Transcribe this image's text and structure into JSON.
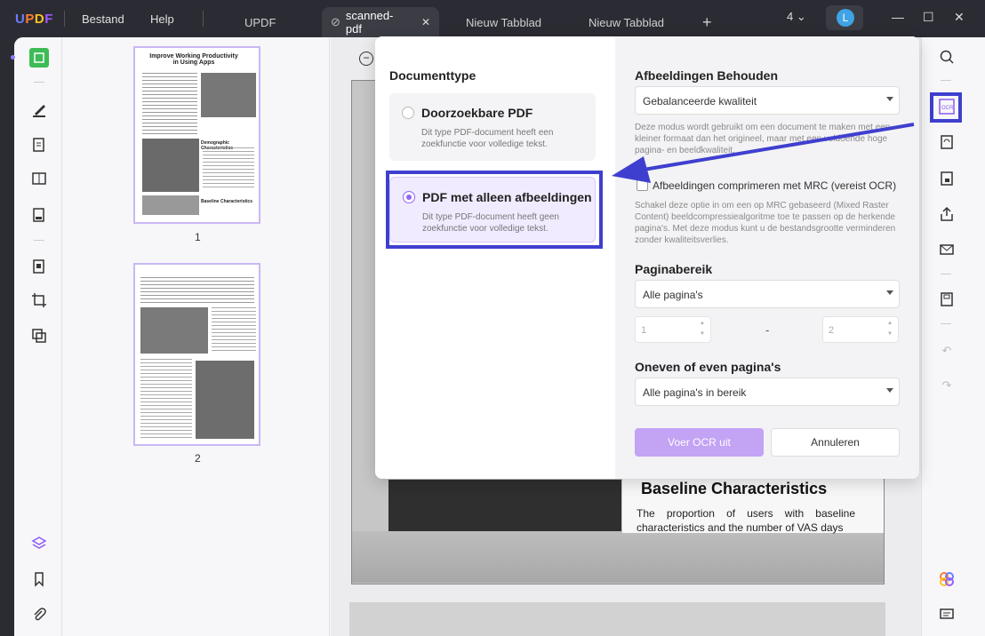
{
  "app": {
    "logo": "UPDF",
    "menu": {
      "file": "Bestand",
      "help": "Help"
    },
    "tabs": [
      {
        "label": "UPDF"
      },
      {
        "label": "scanned-pdf",
        "active": true
      },
      {
        "label": "Nieuw Tabblad"
      },
      {
        "label": "Nieuw Tabblad"
      }
    ],
    "window_count": "4",
    "user_initial": "L"
  },
  "thumbnails": {
    "pages": [
      {
        "number": "1",
        "heading": "Improve Working Productivity in Using Apps",
        "sub1": "Demographic Characteristics",
        "sub2": "Baseline Characteristics"
      },
      {
        "number": "2"
      }
    ]
  },
  "page": {
    "heading": "Baseline Characteristics",
    "paragraph": "The proportion of users with baseline characteristics and the number of VAS days"
  },
  "dialog": {
    "doc_type_title": "Documenttype",
    "options": [
      {
        "title": "Doorzoekbare PDF",
        "desc": "Dit type PDF-document heeft een zoekfunctie voor volledige tekst.",
        "selected": false
      },
      {
        "title": "PDF met alleen afbeeldingen",
        "desc": "Dit type PDF-document heeft geen zoekfunctie voor volledige tekst.",
        "selected": true
      }
    ],
    "keep_images_title": "Afbeeldingen Behouden",
    "keep_images_value": "Gebalanceerde kwaliteit",
    "keep_images_desc": "Deze modus wordt gebruikt om een document te maken met een kleiner formaat dan het origineel, maar met een voldoende hoge pagina- en beeldkwaliteit.",
    "mrc_label": "Afbeeldingen comprimeren met MRC (vereist OCR)",
    "mrc_desc": "Schakel deze optie in om een op MRC gebaseerd (Mixed Raster Content) beeldcompressiealgoritme toe te passen op de herkende pagina's. Met deze modus kunt u de bestandsgrootte verminderen zonder kwaliteitsverlies.",
    "page_range_title": "Paginabereik",
    "page_range_value": "Alle pagina's",
    "range_from": "1",
    "range_to": "2",
    "range_sep": "-",
    "odd_even_title": "Oneven of even pagina's",
    "odd_even_value": "Alle pagina's in bereik",
    "run_button": "Voer OCR uit",
    "cancel_button": "Annuleren"
  },
  "colors": {
    "accent": "#9266f1",
    "primary_button": "#c3a3f4",
    "annotation": "#3f3fcf"
  }
}
